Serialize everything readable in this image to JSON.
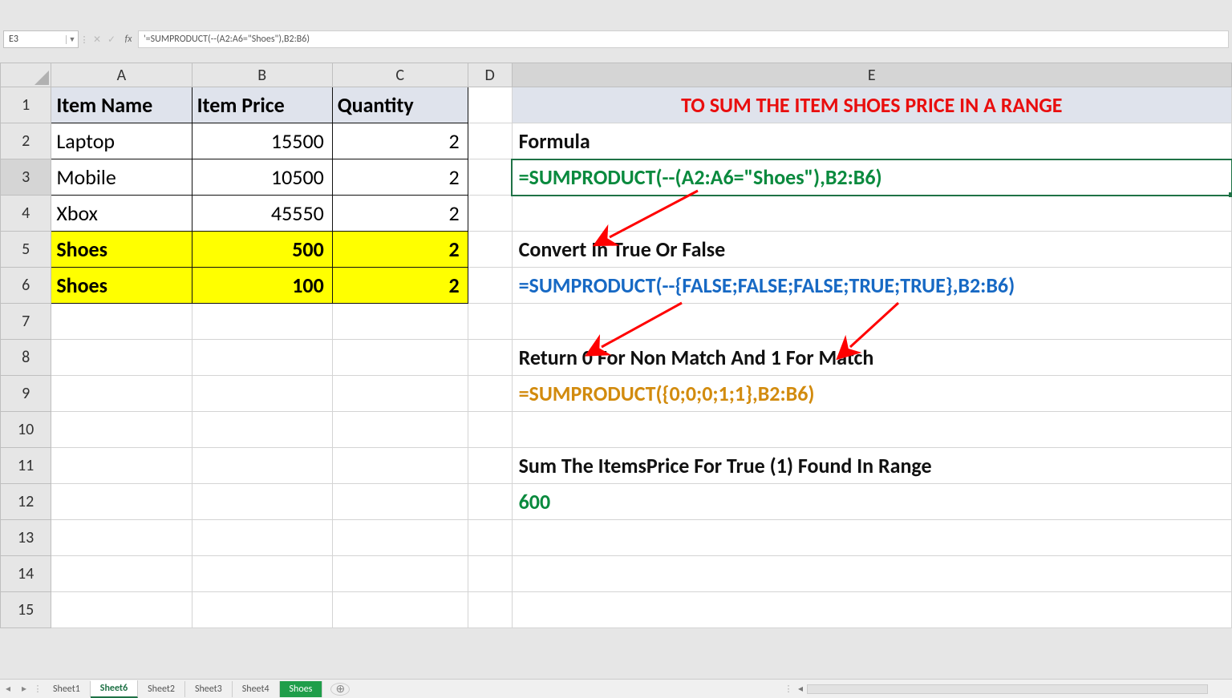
{
  "formula_bar": {
    "name_box": "E3",
    "formula": "'=SUMPRODUCT(--(A2:A6=\"Shoes\"),B2:B6)"
  },
  "columns": [
    "A",
    "B",
    "C",
    "D",
    "E"
  ],
  "rows": [
    "1",
    "2",
    "3",
    "4",
    "5",
    "6",
    "7",
    "8",
    "9",
    "10",
    "11",
    "12",
    "13",
    "14",
    "15"
  ],
  "table": {
    "headers": [
      "Item Name",
      "Item Price",
      "Quantity"
    ],
    "data": [
      {
        "name": "Laptop",
        "price": "15500",
        "qty": "2",
        "hl": false
      },
      {
        "name": "Mobile",
        "price": "10500",
        "qty": "2",
        "hl": false
      },
      {
        "name": "Xbox",
        "price": "45550",
        "qty": "2",
        "hl": false
      },
      {
        "name": "Shoes",
        "price": "500",
        "qty": "2",
        "hl": true
      },
      {
        "name": "Shoes",
        "price": "100",
        "qty": "2",
        "hl": true
      }
    ]
  },
  "explanation": {
    "title": "TO SUM THE ITEM SHOES PRICE IN A RANGE",
    "label_formula": "Formula",
    "formula": "=SUMPRODUCT(--(A2:A6=\"Shoes\"),B2:B6)",
    "label_step2": "Convert In True Or False",
    "step2": "=SUMPRODUCT(--{FALSE;FALSE;FALSE;TRUE;TRUE},B2:B6)",
    "label_step3": "Return 0 For Non Match And 1 For Match",
    "step3": "=SUMPRODUCT({0;0;0;1;1},B2:B6)",
    "label_step4": "Sum The ItemsPrice For True (1) Found In Range",
    "result": "600"
  },
  "tabs": [
    "Sheet1",
    "Sheet6",
    "Sheet2",
    "Sheet3",
    "Sheet4",
    "Shoes"
  ],
  "active_tab": "Sheet6",
  "chart_data": {
    "type": "table",
    "columns": [
      "Item Name",
      "Item Price",
      "Quantity"
    ],
    "rows": [
      [
        "Laptop",
        15500,
        2
      ],
      [
        "Mobile",
        10500,
        2
      ],
      [
        "Xbox",
        45550,
        2
      ],
      [
        "Shoes",
        500,
        2
      ],
      [
        "Shoes",
        100,
        2
      ]
    ],
    "derived": {
      "criterion": "Item Name = \"Shoes\"",
      "sum_of_Item_Price_where_match": 600
    }
  }
}
